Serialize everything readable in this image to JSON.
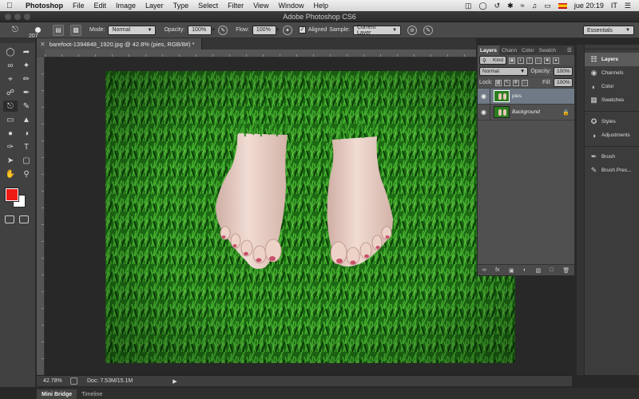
{
  "menubar": {
    "app_name": "Photoshop",
    "items": [
      "File",
      "Edit",
      "Image",
      "Layer",
      "Type",
      "Select",
      "Filter",
      "View",
      "Window",
      "Help"
    ],
    "clock": "jue 20:19",
    "input_locale": "IT"
  },
  "window": {
    "title": "Adobe Photoshop CS6"
  },
  "options": {
    "brush_size": "207",
    "mode_label": "Mode:",
    "mode_value": "Normal",
    "opacity_label": "Opacity:",
    "opacity_value": "100%",
    "flow_label": "Flow:",
    "flow_value": "100%",
    "aligned_label": "Aligned",
    "sample_label": "Sample:",
    "sample_value": "Current Layer",
    "workspace": "Essentials"
  },
  "document": {
    "tab_title": "barefoot-1394848_1920.jpg @ 42.8% (pies, RGB/8#) *",
    "zoom": "42.78%",
    "doc_size": "Doc: 7.53M/15.1M"
  },
  "bottom_tabs": [
    "Mini Bridge",
    "Timeline"
  ],
  "layers_panel": {
    "tabs": [
      "Layers",
      "Chann",
      "Color",
      "Swatch"
    ],
    "kind_label": "Kind",
    "blend_mode": "Normal",
    "opacity_label": "Opacity:",
    "opacity_value": "100%",
    "lock_label": "Lock:",
    "fill_label": "Fill:",
    "fill_value": "100%",
    "layers": [
      {
        "name": "pies",
        "selected": true
      },
      {
        "name": "Background",
        "selected": false
      }
    ]
  },
  "dock": {
    "items": [
      "Layers",
      "Channels",
      "Color",
      "Swatches",
      "Styles",
      "Adjustments",
      "Brush",
      "Brush Pres..."
    ]
  },
  "colors": {
    "foreground": "#ee1b17",
    "background": "#ffffff",
    "grass_dark": "#0f4a0c",
    "grass_light": "#3fae2c",
    "skin": "#e9cfc4"
  }
}
